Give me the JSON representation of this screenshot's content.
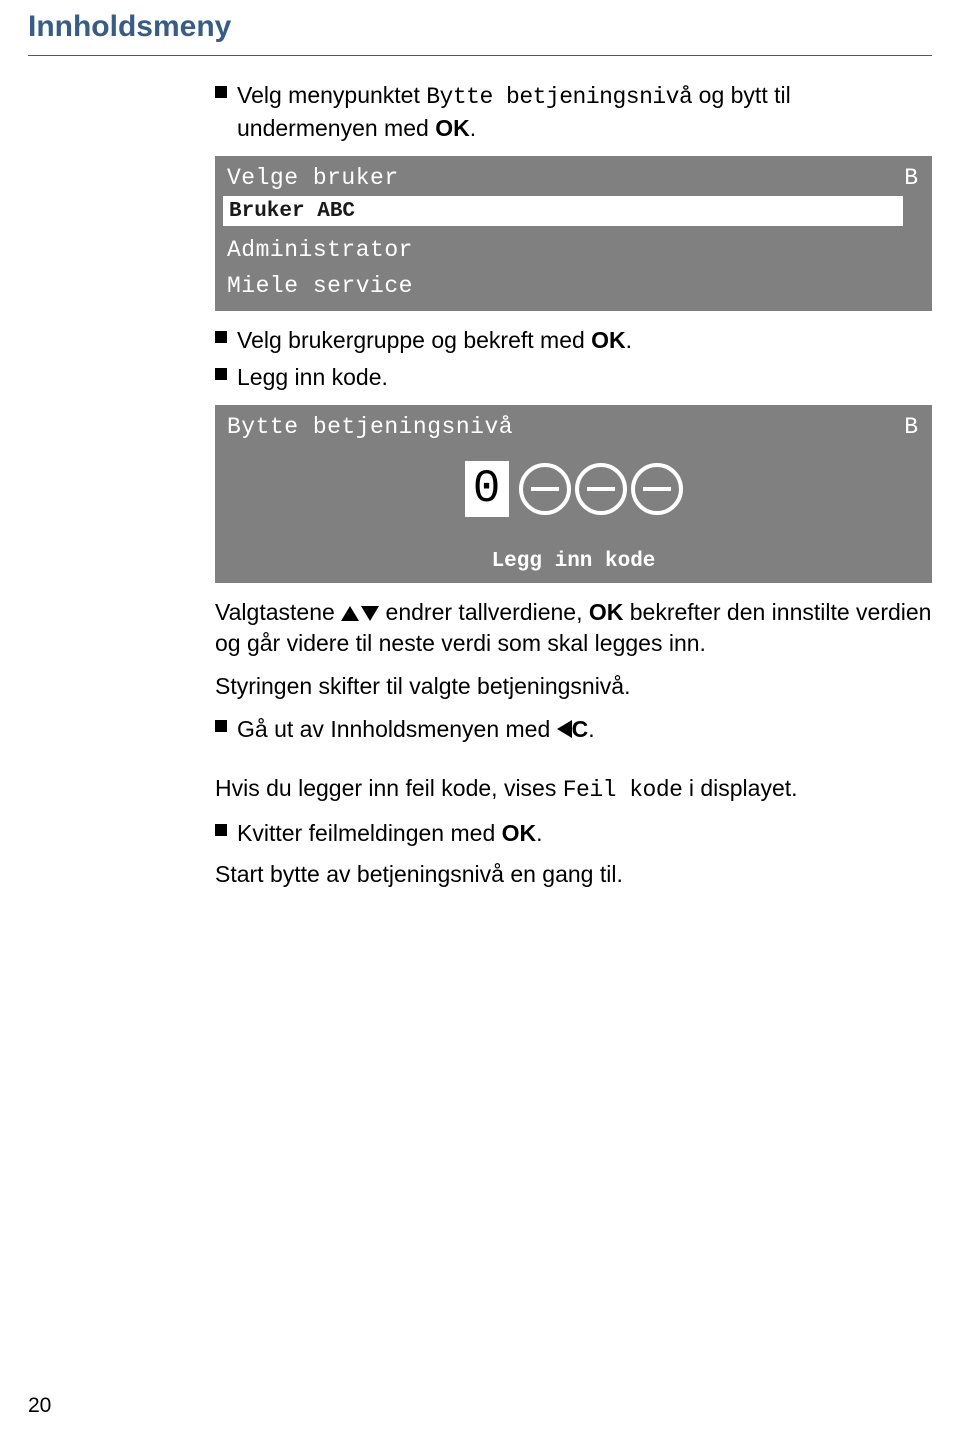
{
  "page": {
    "section_title": "Innholdsmeny",
    "page_number": "20"
  },
  "steps": {
    "step1_pre": "Velg menypunktet ",
    "step1_menu": "Bytte betjeningsnivå",
    "step1_post": " og bytt til undermenyen med ",
    "step1_ok": "OK",
    "step1_end": ".",
    "step2_pre": "Velg brukergruppe og bekreft med ",
    "step2_ok": "OK",
    "step2_end": ".",
    "step3": "Legg inn kode.",
    "step4_pre": "Gå ut av Innholdsmenyen med ",
    "step4_key": "C",
    "step4_end": ".",
    "step5_pre": "Kvitter feilmeldingen med ",
    "step5_ok": "OK",
    "step5_end": "."
  },
  "display1": {
    "title": "Velge bruker",
    "marker": "B",
    "row_selected": "Bruker ABC",
    "row2": "Administrator",
    "row3": "Miele service"
  },
  "display2": {
    "title": "Bytte betjeningsnivå",
    "marker": "B",
    "digit": "0",
    "caption": "Legg inn kode"
  },
  "paras": {
    "p1a": "Valgtastene ",
    "p1b": " endrer tallverdiene, ",
    "p1_ok": "OK",
    "p1c": " bekrefter den innstilte verdien og går videre til neste verdi som skal legges inn.",
    "p2": "Styringen skifter til valgte betjeningsnivå.",
    "p3a": "Hvis du legger inn feil kode, vises ",
    "p3_pixel": "Feil kode",
    "p3b": " i displayet.",
    "p4": "Start bytte av betjeningsnivå en gang til."
  }
}
